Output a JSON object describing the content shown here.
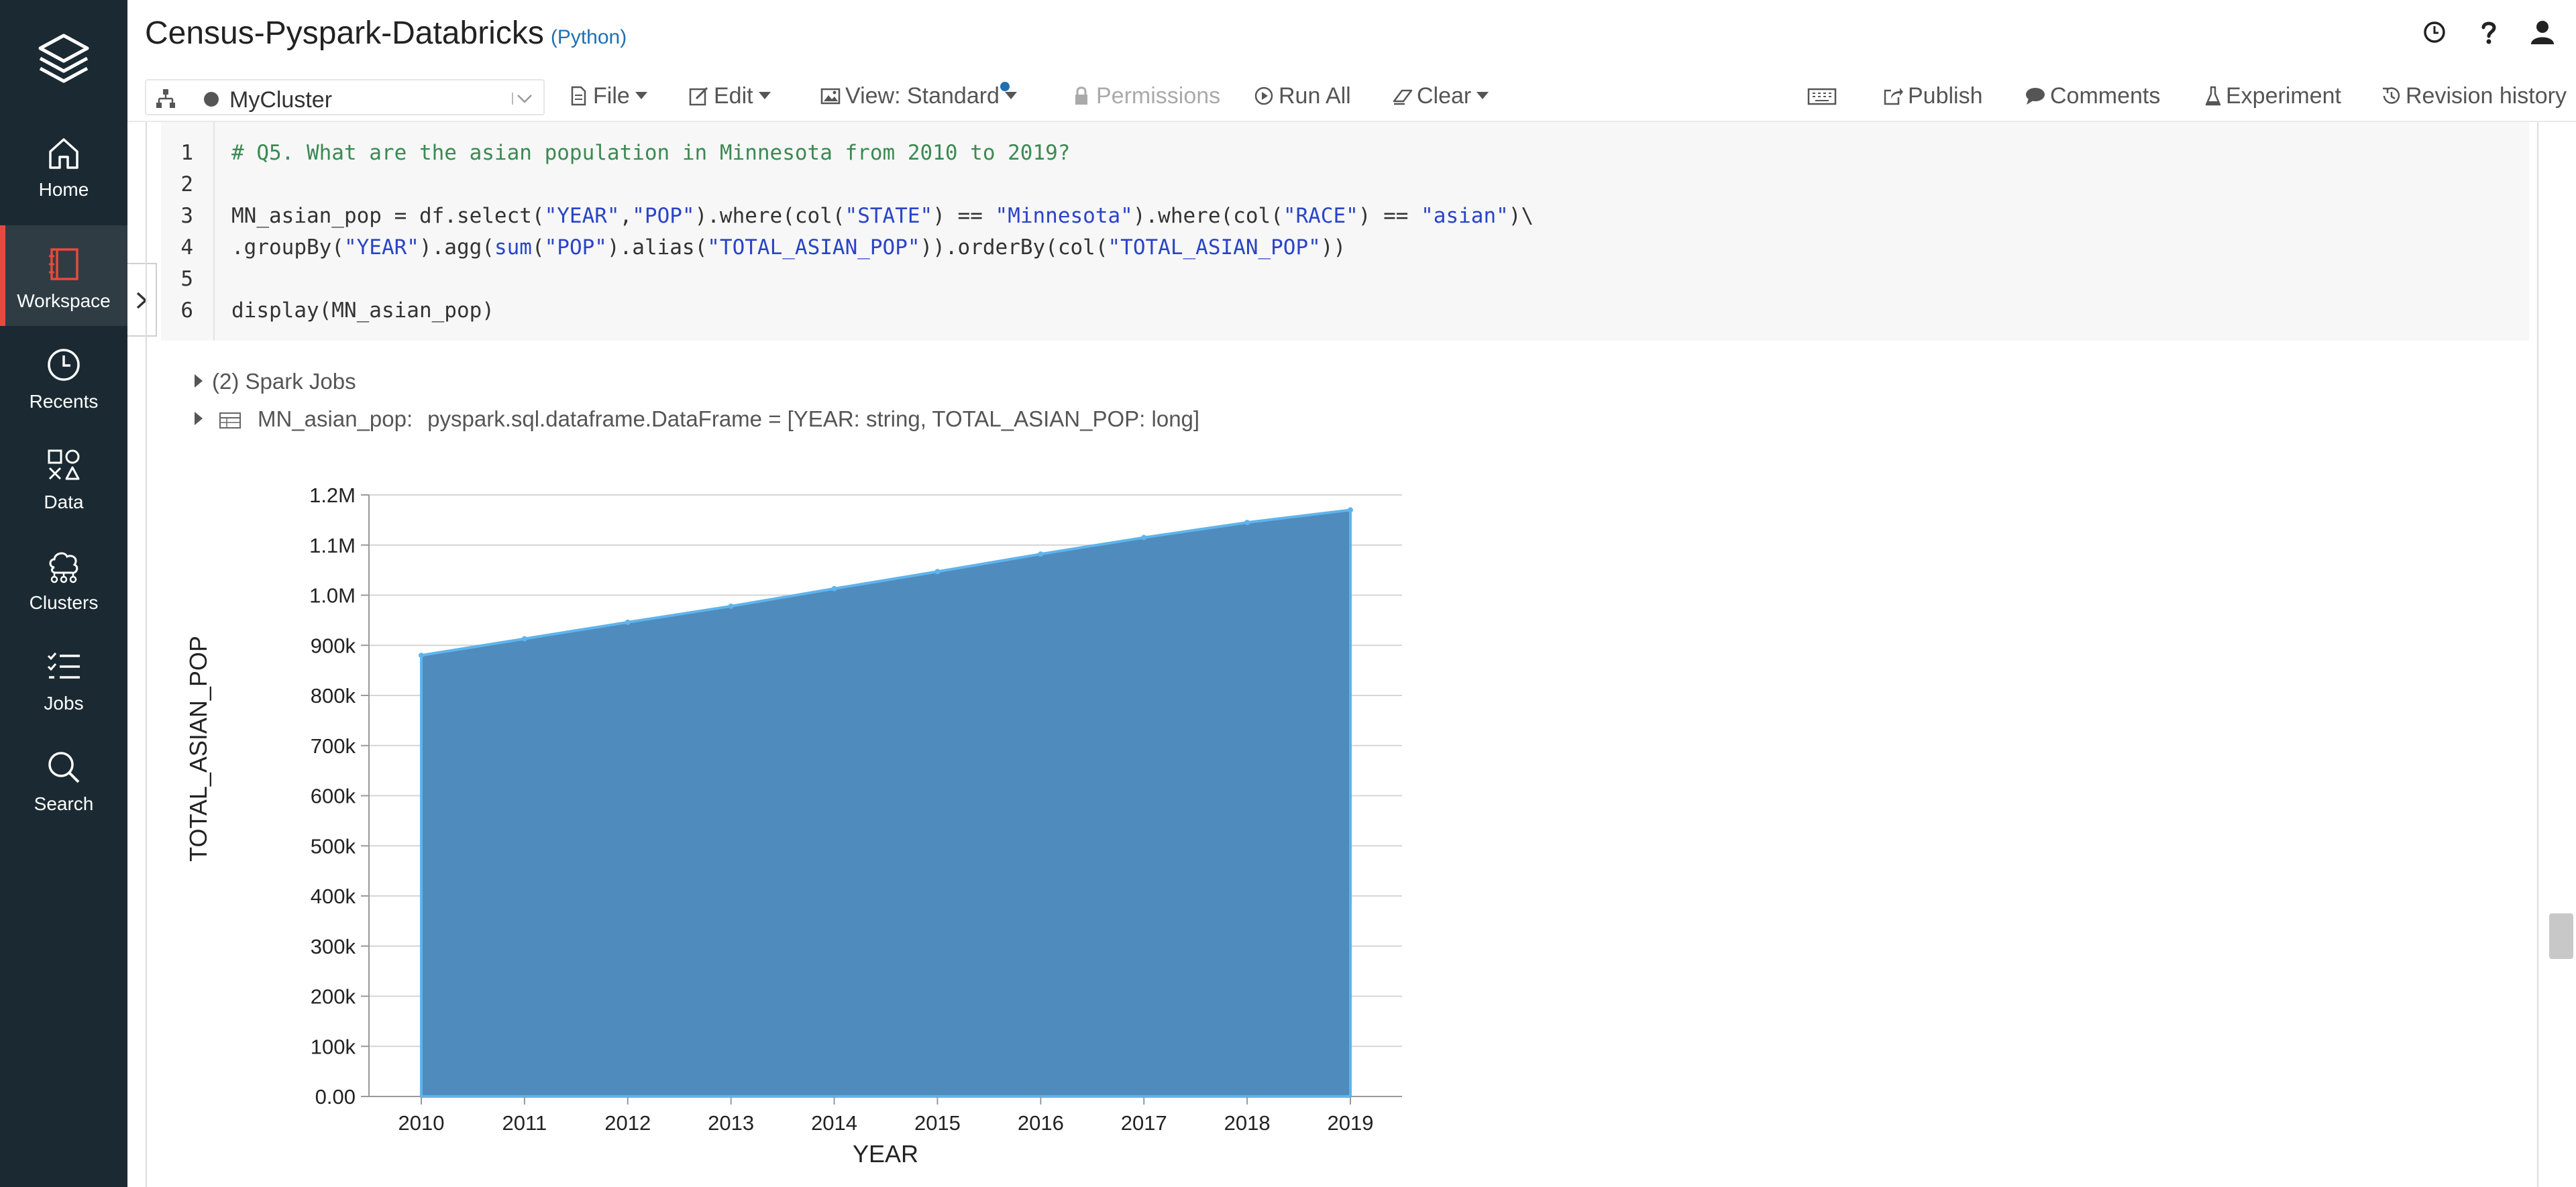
{
  "sidebar": {
    "items": [
      {
        "label": "Home",
        "icon": "home-icon"
      },
      {
        "label": "Workspace",
        "icon": "workspace-icon",
        "active": true
      },
      {
        "label": "Recents",
        "icon": "clock-icon"
      },
      {
        "label": "Data",
        "icon": "data-icon"
      },
      {
        "label": "Clusters",
        "icon": "clusters-icon"
      },
      {
        "label": "Jobs",
        "icon": "jobs-icon"
      },
      {
        "label": "Search",
        "icon": "search-icon"
      }
    ],
    "accent_color": "#e54b3c"
  },
  "header": {
    "title": "Census-Pyspark-Databricks",
    "language": "(Python)"
  },
  "toolbar": {
    "cluster": "MyCluster",
    "file": "File",
    "edit": "Edit",
    "view": "View: Standard",
    "permissions": "Permissions",
    "run_all": "Run All",
    "clear": "Clear",
    "publish": "Publish",
    "comments": "Comments",
    "experiment": "Experiment",
    "revision_history": "Revision history"
  },
  "cell": {
    "line_numbers": [
      "1",
      "2",
      "3",
      "4",
      "5",
      "6"
    ],
    "comment": "# Q5. What are the asian population in Minnesota from 2010 to 2019?",
    "line3": {
      "p1": "MN_asian_pop = df.select(",
      "s1": "\"YEAR\"",
      "p2": ",",
      "s2": "\"POP\"",
      "p3": ").where(col(",
      "s3": "\"STATE\"",
      "p4": ") == ",
      "s4": "\"Minnesota\"",
      "p5": ").where(col(",
      "s5": "\"RACE\"",
      "p6": ") == ",
      "s6": "\"asian\"",
      "p7": ")\\"
    },
    "line4": {
      "p1": ".groupBy(",
      "s1": "\"YEAR\"",
      "p2": ").agg(",
      "k1": "sum",
      "p3": "(",
      "s2": "\"POP\"",
      "p4": ").alias(",
      "s3": "\"TOTAL_ASIAN_POP\"",
      "p5": ")).orderBy(col(",
      "s4": "\"TOTAL_ASIAN_POP\"",
      "p6": "))"
    },
    "line6": "display(MN_asian_pop)"
  },
  "output": {
    "spark_jobs": "(2) Spark Jobs",
    "df_name": "MN_asian_pop:",
    "df_schema": "pyspark.sql.dataframe.DataFrame = [YEAR: string, TOTAL_ASIAN_POP: long]"
  },
  "chart_data": {
    "type": "area",
    "x": [
      "2010",
      "2011",
      "2012",
      "2013",
      "2014",
      "2015",
      "2016",
      "2017",
      "2018",
      "2019"
    ],
    "series": [
      {
        "values": [
          880000,
          913000,
          946000,
          978000,
          1013000,
          1047000,
          1082000,
          1115000,
          1145000,
          1170000
        ]
      }
    ],
    "xlabel": "YEAR",
    "ylabel": "TOTAL_ASIAN_POP",
    "ylim": [
      0,
      1200000
    ],
    "yticks": [
      {
        "v": 0,
        "label": "0.00"
      },
      {
        "v": 100000,
        "label": "100k"
      },
      {
        "v": 200000,
        "label": "200k"
      },
      {
        "v": 300000,
        "label": "300k"
      },
      {
        "v": 400000,
        "label": "400k"
      },
      {
        "v": 500000,
        "label": "500k"
      },
      {
        "v": 600000,
        "label": "600k"
      },
      {
        "v": 700000,
        "label": "700k"
      },
      {
        "v": 800000,
        "label": "800k"
      },
      {
        "v": 900000,
        "label": "900k"
      },
      {
        "v": 1000000,
        "label": "1.0M"
      },
      {
        "v": 1100000,
        "label": "1.1M"
      },
      {
        "v": 1200000,
        "label": "1.2M"
      }
    ],
    "grid": true,
    "fill_color": "#4f8bbd",
    "line_color": "#5fb4ec"
  }
}
